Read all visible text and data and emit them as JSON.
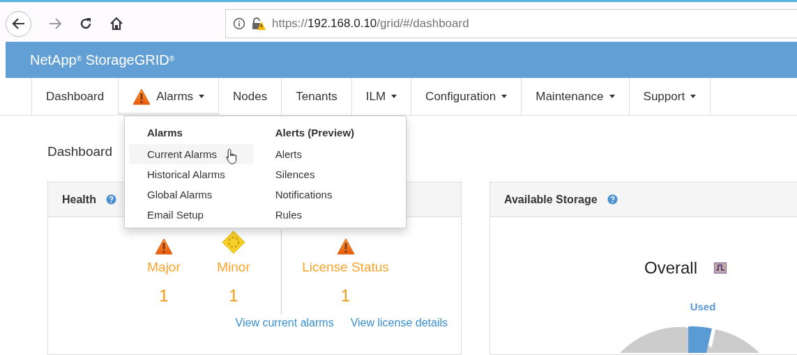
{
  "browser": {
    "url_parts": [
      {
        "text": "https://",
        "kind": "dim"
      },
      {
        "text": "192.168.0.10",
        "kind": "host"
      },
      {
        "text": "/grid/#/dashboard",
        "kind": "dim"
      }
    ]
  },
  "header": {
    "brand": "NetApp$^{®}$ StorageGRID$^{®}$"
  },
  "nav": [
    {
      "label": "Dashboard",
      "caret": false,
      "expanded": false
    },
    {
      "label": "Alarms",
      "caret": true,
      "expanded": true,
      "kind": "alarm"
    },
    {
      "label": "Nodes",
      "caret": false,
      "expanded": false
    },
    {
      "label": "Tenants",
      "caret": false,
      "expanded": false
    },
    {
      "label": "ILM",
      "caret": true,
      "expanded": false
    },
    {
      "label": "Configuration",
      "caret": true,
      "expanded": false
    },
    {
      "label": "Maintenance",
      "caret": true,
      "expanded": false
    },
    {
      "label": "Support",
      "caret": true,
      "expanded": false
    }
  ],
  "dropdown": {
    "columns": [
      {
        "heading": "Alarms",
        "items": [
          {
            "label": "Current Alarms",
            "selected": true
          },
          {
            "label": "Historical Alarms",
            "selected": false
          },
          {
            "label": "Global Alarms",
            "selected": false
          },
          {
            "label": "Email Setup",
            "selected": false
          }
        ]
      },
      {
        "heading": "Alerts (Preview)",
        "items": [
          {
            "label": "Alerts",
            "selected": false
          },
          {
            "label": "Silences",
            "selected": false
          },
          {
            "label": "Notifications",
            "selected": false
          },
          {
            "label": "Rules",
            "selected": false
          }
        ]
      }
    ]
  },
  "breadcrumb": "Dashboard",
  "health": {
    "title": "Health",
    "groups": [
      [
        {
          "kind": "major",
          "label": "Major",
          "count": "1"
        },
        {
          "kind": "minor",
          "label": "Minor",
          "count": "1"
        }
      ],
      [
        {
          "kind": "major",
          "label": "License Status",
          "count": "1"
        }
      ]
    ],
    "links": [
      "View current alarms",
      "View license details"
    ]
  },
  "storage": {
    "title": "Available Storage",
    "chart_title": "Overall",
    "legend": "Used"
  }
}
